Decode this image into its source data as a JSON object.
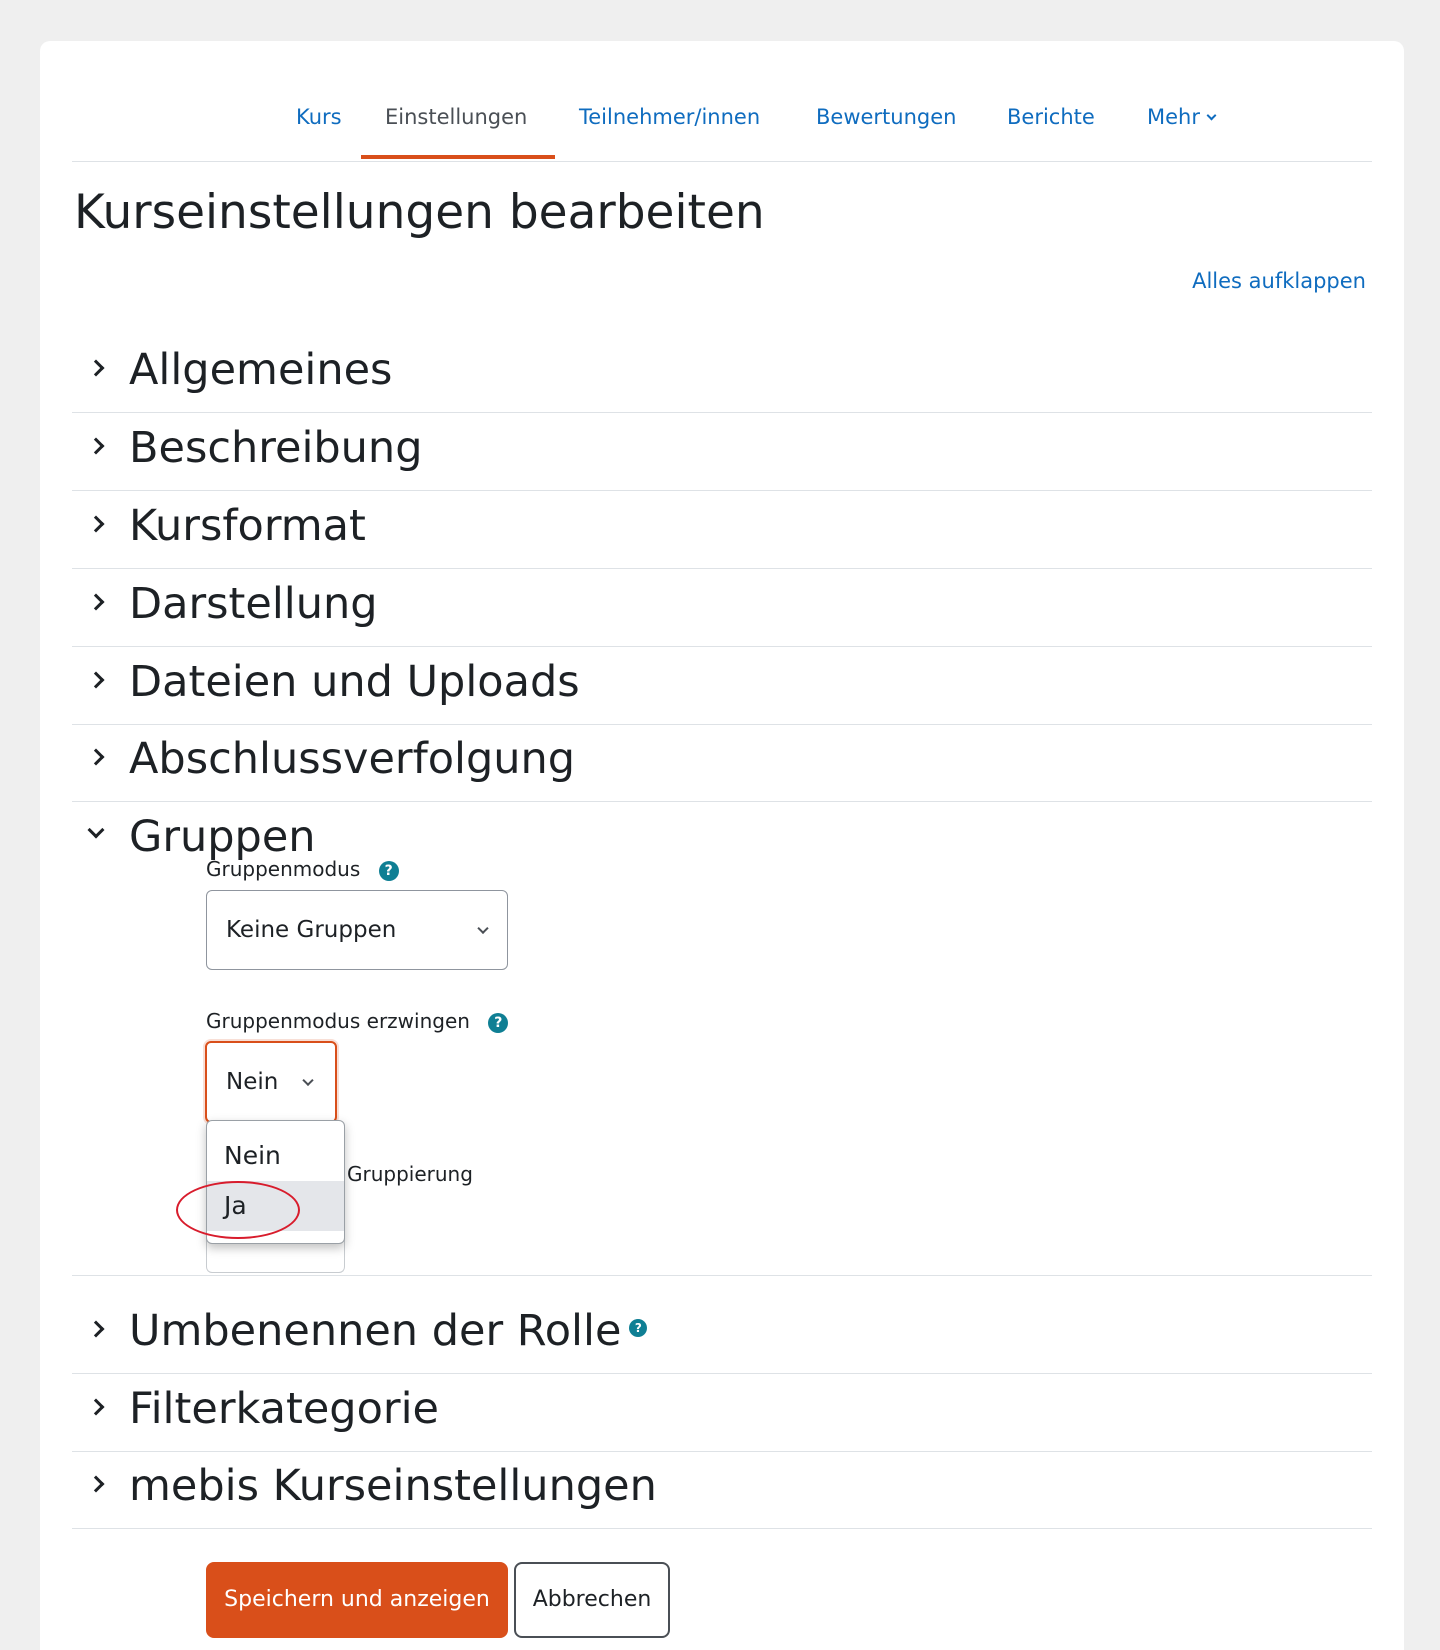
{
  "nav": {
    "items": [
      {
        "label": "Kurs",
        "active": false
      },
      {
        "label": "Einstellungen",
        "active": true
      },
      {
        "label": "Teilnehmer/innen",
        "active": false
      },
      {
        "label": "Bewertungen",
        "active": false
      },
      {
        "label": "Berichte",
        "active": false
      },
      {
        "label": "Mehr",
        "active": false
      }
    ]
  },
  "page_title": "Kurseinstellungen bearbeiten",
  "expand_all_label": "Alles aufklappen",
  "sections": {
    "allgemeines": "Allgemeines",
    "beschreibung": "Beschreibung",
    "kursformat": "Kursformat",
    "darstellung": "Darstellung",
    "dateien": "Dateien und Uploads",
    "abschluss": "Abschlussverfolgung",
    "gruppen": "Gruppen",
    "rolle": "Umbenennen der Rolle",
    "filter": "Filterkategorie",
    "mebis": "mebis Kurseinstellungen"
  },
  "groups": {
    "group_mode_label": "Gruppenmodus",
    "group_mode_value": "Keine Gruppen",
    "force_label": "Gruppenmodus erzwingen",
    "force_value": "Nein",
    "force_options": [
      "Nein",
      "Ja"
    ],
    "grouping_label_partial": "Gruppierung"
  },
  "icons": {
    "help": "?"
  },
  "buttons": {
    "save": "Speichern und anzeigen",
    "cancel": "Abbrechen"
  },
  "colors": {
    "accent": "#d94f1a",
    "link": "#0f6cbf",
    "help_icon": "#0f7f94",
    "annotation": "#d81c2c"
  }
}
